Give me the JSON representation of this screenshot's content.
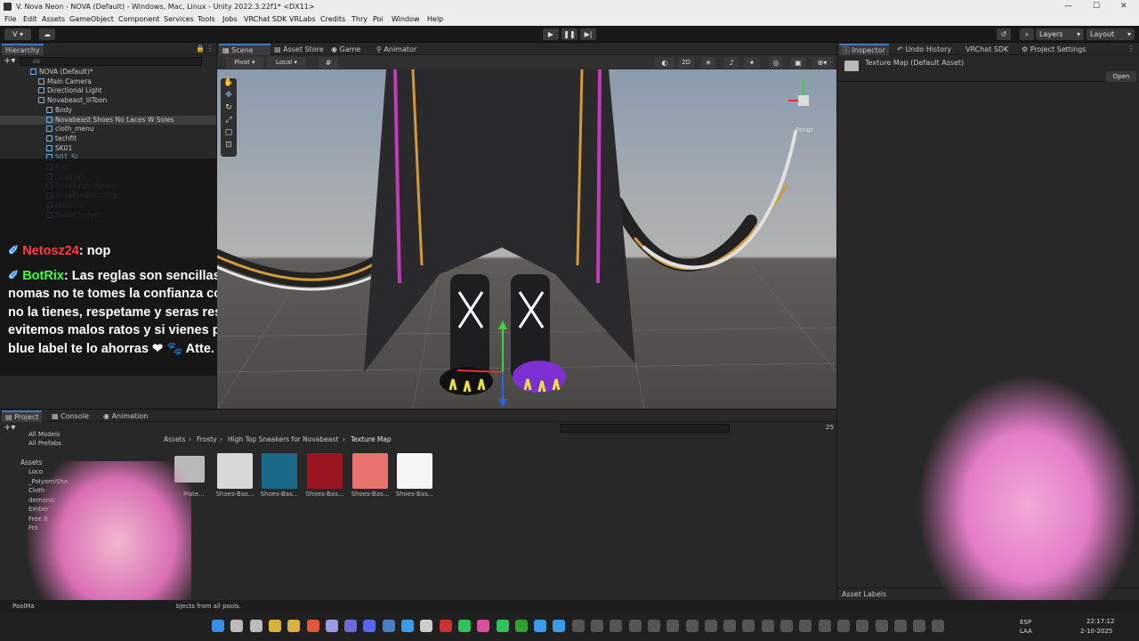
{
  "window": {
    "title": "V. Nova Neon - NOVA (Default) - Windows, Mac, Linux - Unity 2022.3.22f1* <DX11>"
  },
  "menu": [
    "File",
    "Edit",
    "Assets",
    "GameObject",
    "Component",
    "Services",
    "Tools",
    "Jobs",
    "VRChat SDK",
    "VRLabs",
    "Credits",
    "Thry",
    "Poi",
    "Window",
    "Help"
  ],
  "toolbar": {
    "layers_label": "Layers",
    "layout_label": "Layout",
    "account_label": "V"
  },
  "hierarchy": {
    "tab": "Hierarchy",
    "search_placeholder": "All",
    "items": [
      {
        "label": "NOVA (Default)*",
        "indent": 0
      },
      {
        "label": "Main Camera",
        "indent": 1
      },
      {
        "label": "Directional Light",
        "indent": 1
      },
      {
        "label": "Novabeast_lilToon",
        "indent": 1
      },
      {
        "label": "Body",
        "indent": 2
      },
      {
        "label": "Novabeast Shoes No Laces W Soles",
        "indent": 2
      },
      {
        "label": "cloth_menu",
        "indent": 2
      },
      {
        "label": "techfit",
        "indent": 2
      },
      {
        "label": "SK01",
        "indent": 2
      },
      {
        "label": "S01_Sl",
        "indent": 2
      },
      {
        "label": "PO2",
        "indent": 2
      },
      {
        "label": "NovaTw6",
        "indent": 2
      },
      {
        "label": "NovaRings Variant",
        "indent": 2
      },
      {
        "label": "NovaFireBreathing",
        "indent": 2
      },
      {
        "label": "skeleton",
        "indent": 2
      },
      {
        "label": "SnootContact",
        "indent": 2
      }
    ]
  },
  "chat": {
    "messages": [
      {
        "user": "Netosz24",
        "user_color": "#ff3b3b",
        "text": " nop"
      },
      {
        "user": "BotRix",
        "user_color": "#3cff3c",
        "text": " Las reglas son sencillas,"
      },
      {
        "user": "",
        "user_color": "",
        "text": "nomas no te tomes la confianza con quien"
      },
      {
        "user": "",
        "user_color": "",
        "text": "no la tienes, respetame y seras respetado,"
      },
      {
        "user": "",
        "user_color": "",
        "text": "evitemos malos ratos y si vienes por un"
      },
      {
        "user": "",
        "user_color": "",
        "text": "blue label te lo ahorras ❤ 🐾 Atte. La Furra"
      }
    ]
  },
  "scene": {
    "tabs": [
      "Scene",
      "Asset Store",
      "Game",
      "Animator"
    ],
    "pivot_label": "Pivot",
    "local_label": "Local",
    "mode_2d": "2D",
    "persp_label": "Persp"
  },
  "inspector": {
    "tabs": [
      "Inspector",
      "Undo History",
      "VRChat SDK",
      "Project Settings"
    ],
    "asset_title": "Texture Map (Default Asset)",
    "open_button": "Open",
    "asset_labels": "Asset Labels"
  },
  "project": {
    "tabs": [
      "Project",
      "Console",
      "Animation"
    ],
    "favorites": [
      "All Models",
      "All Prefabs"
    ],
    "assets_root": "Assets",
    "tree": [
      "Loco",
      "_PolyomiSha",
      "Cloth",
      "demonic",
      "Ember",
      "Free B",
      "Fro"
    ],
    "breadcrumb": [
      "Assets",
      "Frosty",
      "High Top Sneakers for Novabeast",
      "Texture Map"
    ],
    "item_count": "25",
    "items": [
      {
        "label": "Shoes-Bas...",
        "color": "#d8d8d8"
      },
      {
        "label": "Shoes-Bas...",
        "color": "#1b6a8a"
      },
      {
        "label": "Shoes-Bas...",
        "color": "#9b1520"
      },
      {
        "label": "Shoes-Bas...",
        "color": "#e8736f"
      },
      {
        "label": "Shoes-Bas...",
        "color": "#f5f5f5"
      }
    ],
    "folder_label": "Mate..."
  },
  "status": {
    "message": "bjects from all pools.",
    "app_label": "PoolMa"
  },
  "taskbar": {
    "lang": "ESP",
    "region": "LAA",
    "time": "22:17:12",
    "date": "2-10-2025"
  }
}
